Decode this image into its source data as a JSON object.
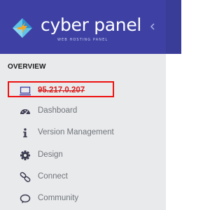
{
  "brand": {
    "name": "cyber panel",
    "tagline": "WEB HOSTING PANEL",
    "header_color": "#3e41a3"
  },
  "header": {
    "collapse_icon": "chevron-left-icon"
  },
  "sidebar": {
    "section_title": "OVERVIEW",
    "server_ip": "95.217.0.207",
    "items": [
      {
        "label": "Dashboard",
        "icon": "dashboard-icon"
      },
      {
        "label": "Version Management",
        "icon": "info-icon"
      },
      {
        "label": "Design",
        "icon": "gear-icon"
      },
      {
        "label": "Connect",
        "icon": "link-icon"
      },
      {
        "label": "Community",
        "icon": "chat-icon"
      }
    ]
  },
  "annotation": {
    "highlight_color": "#ee1111"
  }
}
